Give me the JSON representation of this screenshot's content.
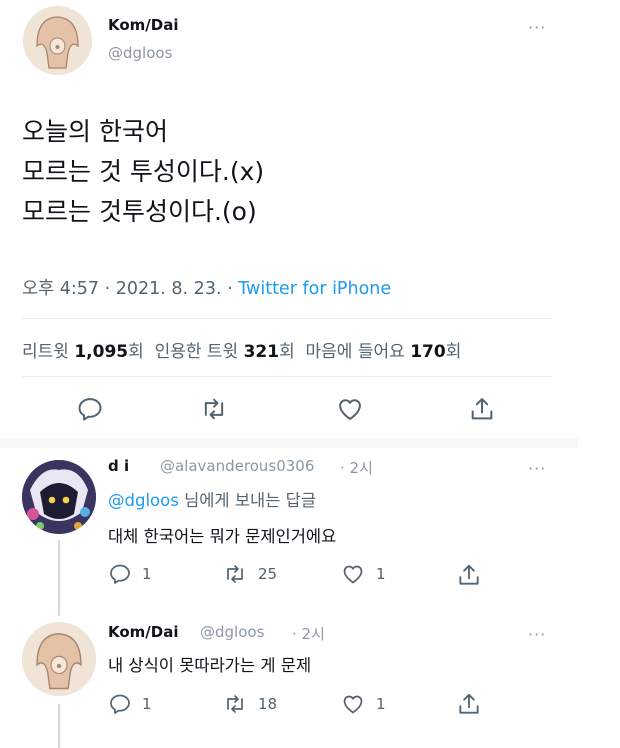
{
  "main_tweet": {
    "author_name": "Kom/Dai",
    "author_handle": "@dgloos",
    "lines": [
      "오늘의 한국어",
      "모르는 것 투성이다.(x)",
      "모르는 것투성이다.(o)"
    ],
    "time": "오후 4:57",
    "date": "2021. 8. 23.",
    "source": "Twitter for iPhone",
    "retweets_label": "리트윗",
    "retweets_count": "1,095",
    "quotes_label": "인용한 트윗",
    "quotes_count": "321",
    "likes_label": "마음에 들어요",
    "likes_count": "170",
    "unit": "회"
  },
  "replies": [
    {
      "author_name": "d i",
      "author_handle": "@alavanderous0306",
      "time": "2시",
      "reply_to_mention": "@dgloos",
      "reply_to_suffix": " 님에게 보내는 답글",
      "text": "대체 한국어는 뭐가 문제인거에요",
      "reply_count": "1",
      "retweet_count": "25",
      "like_count": "1"
    },
    {
      "author_name": "Kom/Dai",
      "author_handle": "@dgloos",
      "time": "2시",
      "text": "내 상식이 못따라가는 게 문제",
      "reply_count": "1",
      "retweet_count": "18",
      "like_count": "1"
    }
  ],
  "more_label": "···",
  "separator": " · ",
  "icons": [
    "reply-icon",
    "retweet-icon",
    "like-icon",
    "share-icon",
    "more-icon"
  ],
  "colors": {
    "link": "#1d9bf0",
    "muted": "#536471",
    "text": "#0f1419"
  }
}
